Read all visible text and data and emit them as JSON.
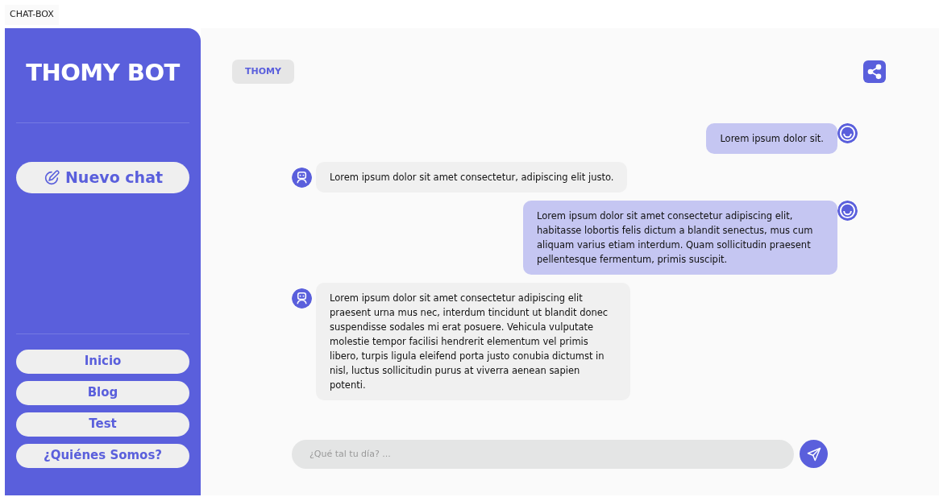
{
  "page_tab": "CHAT-BOX",
  "sidebar": {
    "title": "THOMY BOT",
    "new_chat": "Nuevo chat",
    "nav": [
      {
        "label": "Inicio"
      },
      {
        "label": "Blog"
      },
      {
        "label": "Test"
      },
      {
        "label": "¿Quiénes Somos?"
      }
    ]
  },
  "header": {
    "chip": "THOMY"
  },
  "messages": [
    {
      "kind": "user",
      "text": "Lorem ipsum dolor sit."
    },
    {
      "kind": "bot",
      "text": "Lorem ipsum dolor sit amet consectetur, adipiscing elit justo."
    },
    {
      "kind": "user",
      "text": "Lorem ipsum dolor sit amet consectetur adipiscing elit, habitasse lobortis felis dictum a blandit senectus, mus cum aliquam varius etiam interdum. Quam sollicitudin praesent pellentesque fermentum, primis suscipit."
    },
    {
      "kind": "bot",
      "text": "Lorem ipsum dolor sit amet consectetur adipiscing elit praesent urna mus nec, interdum tincidunt ut blandit donec suspendisse sodales mi erat posuere. Vehicula vulputate molestie tempor facilisi hendrerit elementum vel primis libero, turpis ligula eleifend porta justo conubia dictumst in nisl, luctus sollicitudin purus at viverra aenean sapien potenti."
    }
  ],
  "composer": {
    "placeholder": "¿Qué tal tu día? ..."
  }
}
